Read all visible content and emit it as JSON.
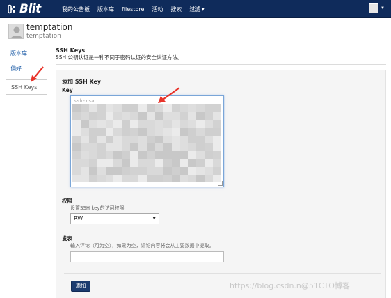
{
  "navbar": {
    "brand": "Blit",
    "items": [
      {
        "label": "我的公告板"
      },
      {
        "label": "版本库"
      },
      {
        "label": "filestore"
      },
      {
        "label": "活动"
      },
      {
        "label": "搜索"
      },
      {
        "label": "过滤"
      }
    ],
    "bg_color": "#0f2b5b"
  },
  "user": {
    "name": "temptation",
    "display_name": "temptation"
  },
  "sidebar": {
    "items": [
      {
        "label": "版本库"
      },
      {
        "label": "偏好"
      },
      {
        "label": "SSH Keys"
      }
    ]
  },
  "section": {
    "title": "SSH Keys",
    "description": "SSH 公钥认证是一种不同于密码认证的安全认证方法。"
  },
  "form": {
    "heading": "添加 SSH Key",
    "key_label": "Key",
    "key_value_prefix": "ssh-rsa",
    "permission_label": "权限",
    "permission_hint": "设置SSH key的访问权限",
    "permission_value": "RW",
    "comment_label": "发表",
    "comment_hint": "输入评论（可为空），如果为空，评论内容将会从主要数据中提取。",
    "comment_value": "",
    "submit_label": "添加"
  },
  "annotation_color": "#e8332a",
  "watermark": "https://blog.csdn.n@51CTO博客"
}
